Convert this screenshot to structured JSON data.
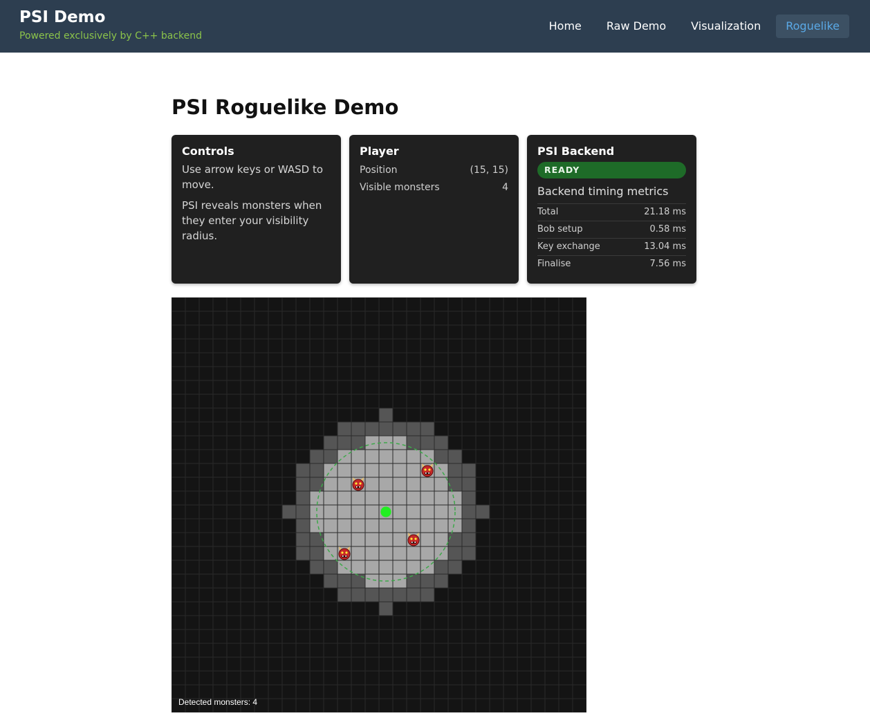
{
  "header": {
    "title": "PSI Demo",
    "subtitle": "Powered exclusively by C++ backend",
    "nav": [
      {
        "label": "Home"
      },
      {
        "label": "Raw Demo"
      },
      {
        "label": "Visualization"
      },
      {
        "label": "Roguelike",
        "active": true
      }
    ]
  },
  "page_title": "PSI Roguelike Demo",
  "controls": {
    "heading": "Controls",
    "text1": "Use arrow keys or WASD to move.",
    "text2": "PSI reveals monsters when they enter your visibility radius."
  },
  "player": {
    "heading": "Player",
    "position_label": "Position",
    "position_value": "(15, 15)",
    "visible_label": "Visible monsters",
    "visible_value": "4"
  },
  "backend": {
    "heading": "PSI Backend",
    "status": "READY",
    "metrics_title": "Backend timing metrics",
    "metrics": [
      {
        "label": "Total",
        "value": "21.18 ms"
      },
      {
        "label": "Bob setup",
        "value": "0.58 ms"
      },
      {
        "label": "Key exchange",
        "value": "13.04 ms"
      },
      {
        "label": "Finalise",
        "value": "7.56 ms"
      }
    ]
  },
  "map": {
    "grid_cols": 30,
    "grid_rows": 30,
    "player": {
      "x": 15,
      "y": 15
    },
    "visibility_radius": 5,
    "monsters": [
      {
        "x": 13,
        "y": 13
      },
      {
        "x": 18,
        "y": 12
      },
      {
        "x": 17,
        "y": 17
      },
      {
        "x": 12,
        "y": 18
      }
    ],
    "monster_icon": "ogre-icon",
    "footer": "Detected monsters: 4",
    "colors": {
      "background": "#141414",
      "grid": "#2a2a2a",
      "explored": "#555555",
      "visible": "#a8a8a8",
      "player": "#22ee22",
      "radius": "#3ea84a"
    }
  },
  "colors": {
    "topbar": "#2d3e50",
    "accent": "#5aa9e6",
    "subtitle": "#8bc34a",
    "ready": "#1e6b28"
  }
}
